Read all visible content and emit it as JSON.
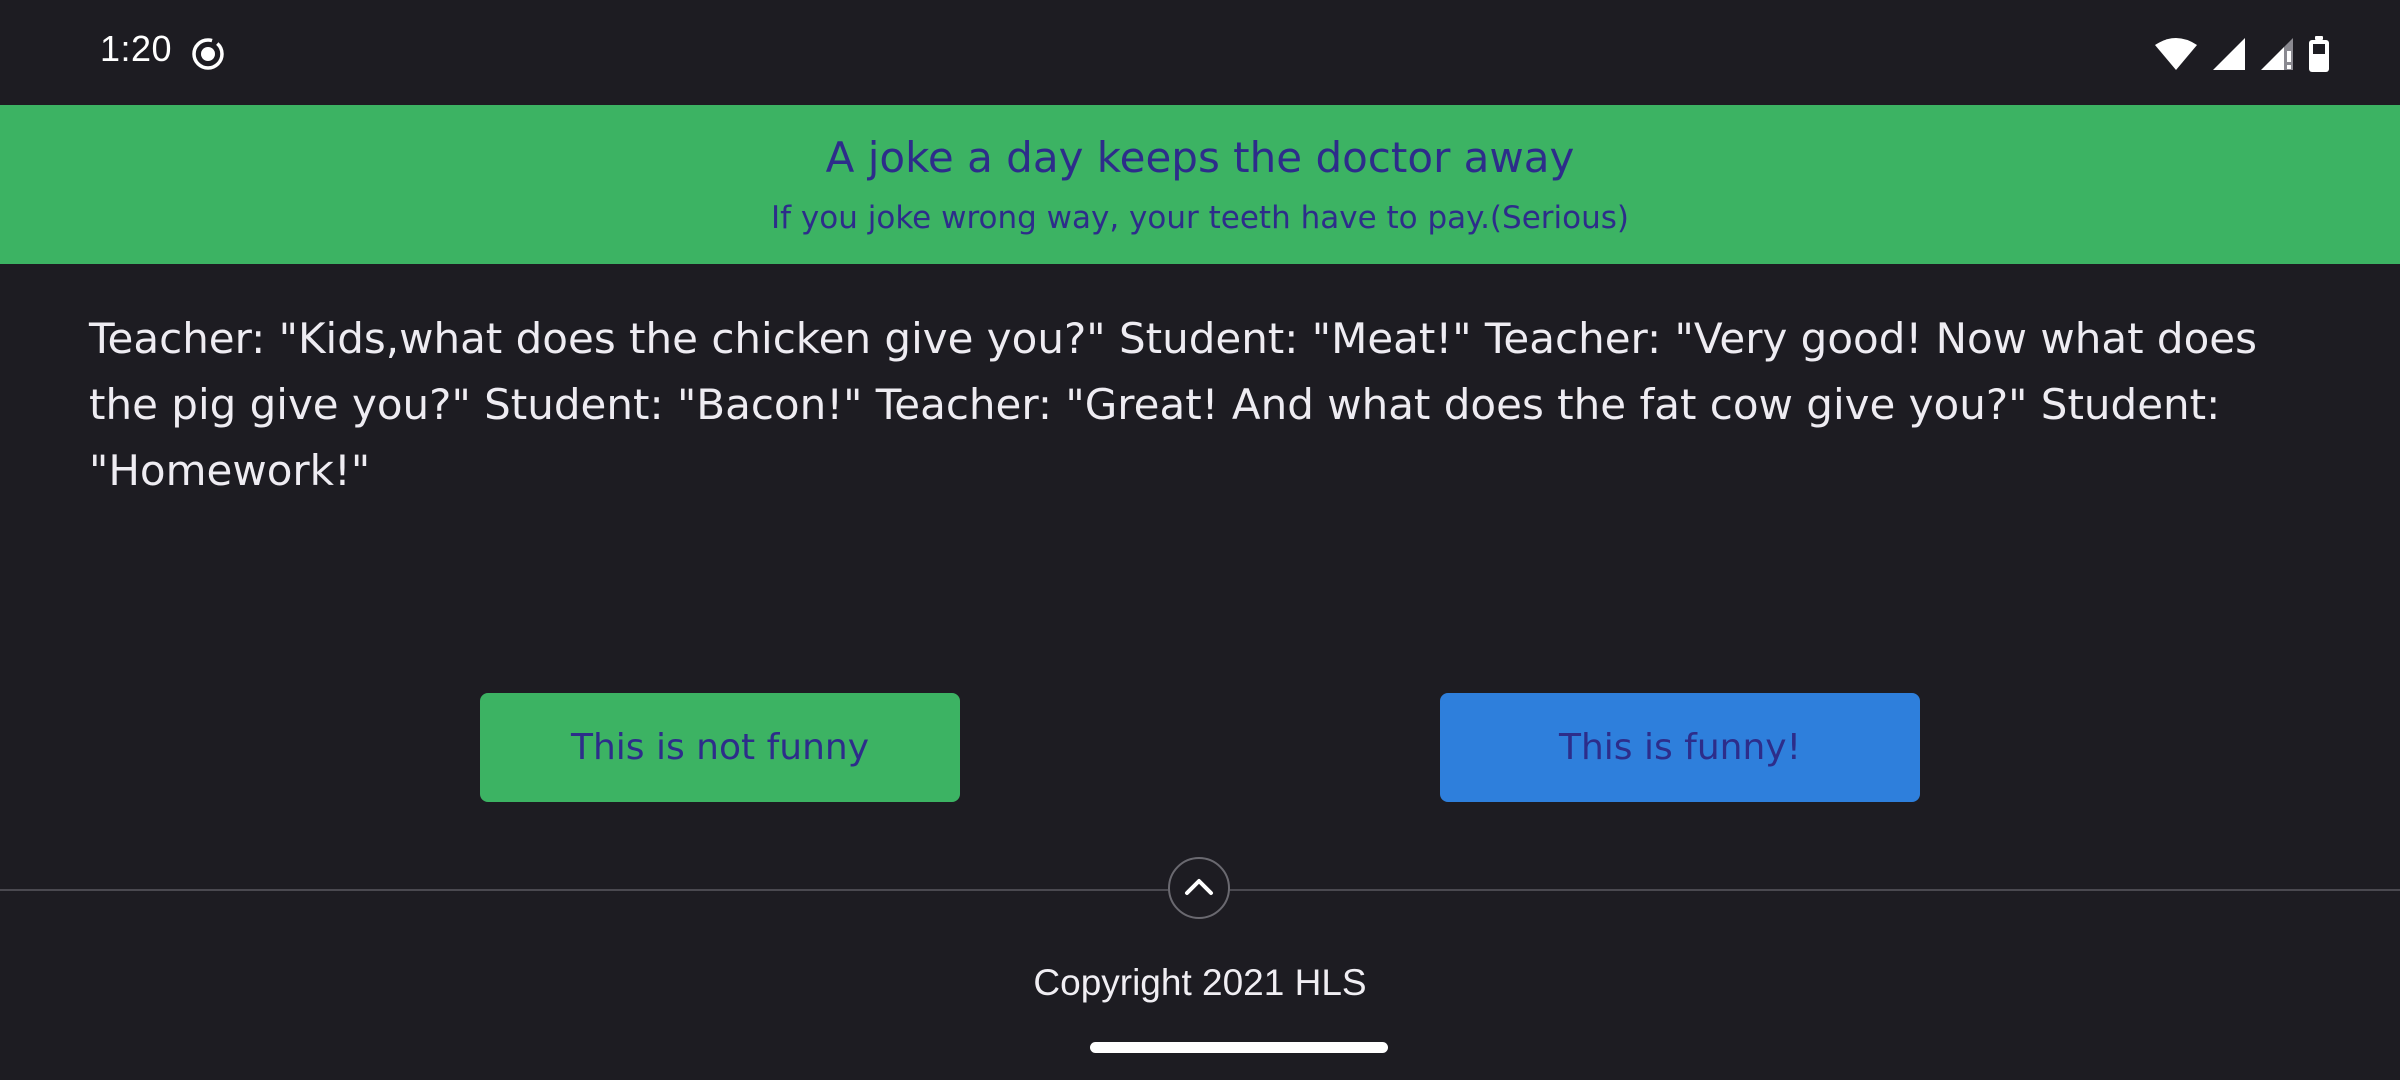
{
  "status_bar": {
    "time": "1:20",
    "icons": [
      "screen-record-icon",
      "wifi-icon",
      "cell-signal-icon",
      "cell-signal-no-data-icon",
      "battery-icon"
    ]
  },
  "banner": {
    "title": "A joke a day keeps the doctor away",
    "subtitle": "If you joke wrong way, your teeth have to pay.(Serious)",
    "background_color": "#3cb363",
    "text_color": "#2d2d8a"
  },
  "joke": {
    "text": "Teacher: \"Kids,what does the chicken give you?\" Student: \"Meat!\" Teacher: \"Very good! Now what does the pig give you?\" Student: \"Bacon!\" Teacher: \"Great! And what does the fat cow give you?\" Student: \"Homework!\""
  },
  "buttons": {
    "not_funny_label": "This is not funny",
    "not_funny_color": "#3cb363",
    "funny_label": "This is funny!",
    "funny_color": "#2e7fdc"
  },
  "footer": {
    "scroll_top_icon": "chevron-up-icon",
    "copyright": "Copyright 2021 HLS"
  },
  "theme": {
    "background": "#1d1c22",
    "text": "#f0eef3"
  }
}
